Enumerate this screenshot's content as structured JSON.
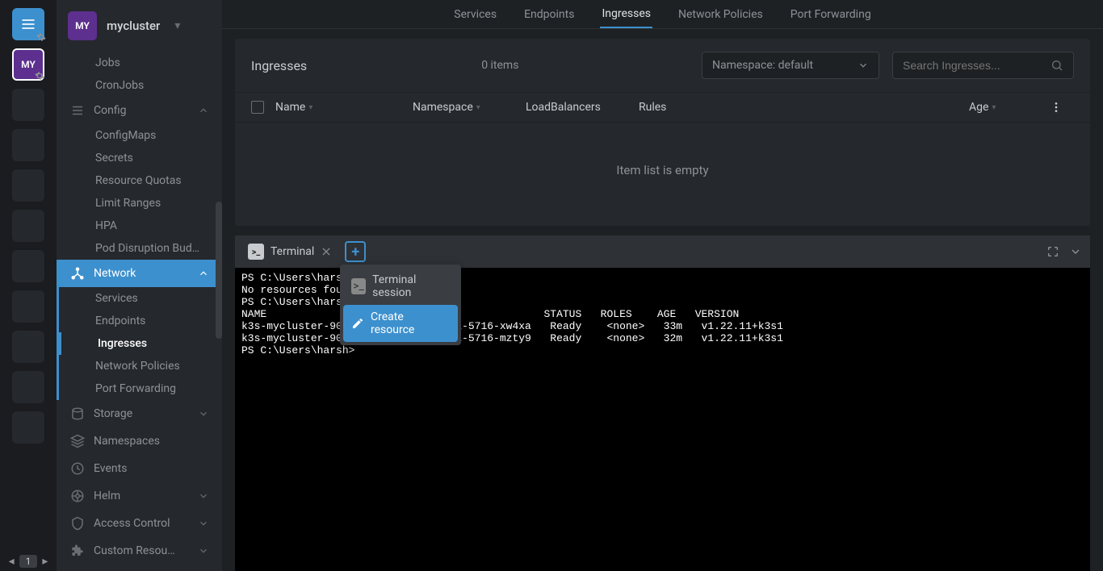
{
  "cluster": {
    "badge": "MY",
    "name": "mycluster"
  },
  "rail": {
    "cluster_badge": "MY",
    "page_num": "1"
  },
  "sidebar": {
    "jobs": "Jobs",
    "cronjobs": "CronJobs",
    "config": "Config",
    "configmaps": "ConfigMaps",
    "secrets": "Secrets",
    "resourcequotas": "Resource Quotas",
    "limitranges": "Limit Ranges",
    "hpa": "HPA",
    "pdb": "Pod Disruption Bud…",
    "network": "Network",
    "services": "Services",
    "endpoints": "Endpoints",
    "ingresses": "Ingresses",
    "netpol": "Network Policies",
    "portfwd": "Port Forwarding",
    "storage": "Storage",
    "namespaces": "Namespaces",
    "events": "Events",
    "helm": "Helm",
    "access": "Access Control",
    "crd": "Custom Resou…"
  },
  "tabs": {
    "services": "Services",
    "endpoints": "Endpoints",
    "ingresses": "Ingresses",
    "netpol": "Network Policies",
    "portfwd": "Port Forwarding"
  },
  "panel": {
    "title": "Ingresses",
    "count": "0 items",
    "ns_label": "Namespace: default",
    "search_placeholder": "Search Ingresses...",
    "empty": "Item list is empty"
  },
  "columns": {
    "name": "Name",
    "namespace": "Namespace",
    "loadbalancers": "LoadBalancers",
    "rules": "Rules",
    "age": "Age"
  },
  "terminal": {
    "tab_label": "Terminal",
    "menu_session": "Terminal session",
    "menu_create": "Create resource",
    "output": "PS C:\\Users\\harsh>\nNo resources found\nPS C:\\Users\\harsh>\nNAME                                            STATUS   ROLES    AGE   VERSION\nk3s-mycluster-9077-51f289-node-pool-5716-xw4xa   Ready    <none>   33m   v1.22.11+k3s1\nk3s-mycluster-9077-51f289-node-pool-5716-mzty9   Ready    <none>   32m   v1.22.11+k3s1\nPS C:\\Users\\harsh> "
  }
}
